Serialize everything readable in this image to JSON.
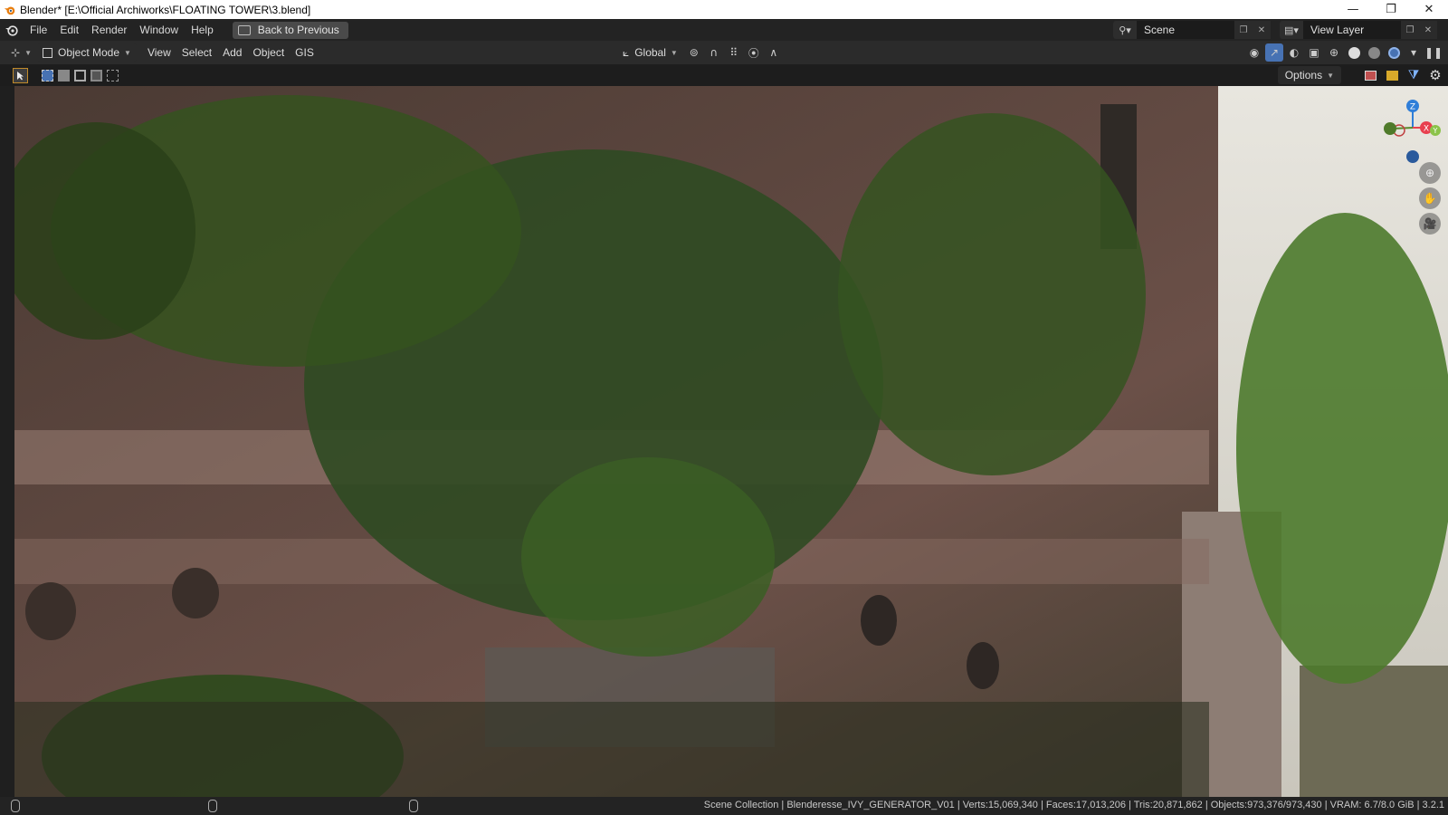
{
  "window": {
    "title": "Blender* [E:\\Official Archiworks\\FLOATING TOWER\\3.blend]",
    "controls": [
      "—",
      "❐",
      "✕"
    ]
  },
  "menubar": {
    "items": [
      "File",
      "Edit",
      "Render",
      "Window",
      "Help"
    ],
    "back_button": "Back to Previous",
    "scene_label": "Scene",
    "view_layer_label": "View Layer"
  },
  "viewport_header": {
    "mode": "Object Mode",
    "menus": [
      "View",
      "Select",
      "Add",
      "Object",
      "GIS"
    ],
    "transform_orientation": "Global"
  },
  "tool_header": {
    "options_label": "Options"
  },
  "gizmo": {
    "axes": [
      "Z",
      "X",
      "Y"
    ]
  },
  "statusbar": {
    "text": "Scene Collection | Blenderesse_IVY_GENERATOR_V01 | Verts:15,069,340 | Faces:17,013,206 | Tris:20,871,862 | Objects:973,376/973,430 | VRAM: 6.7/8.0 GiB | 3.2.1"
  },
  "colors": {
    "accent": "#4772b3",
    "axis_x": "#e8404f",
    "axis_y": "#8bc34a",
    "axis_z": "#2f7ed8"
  }
}
